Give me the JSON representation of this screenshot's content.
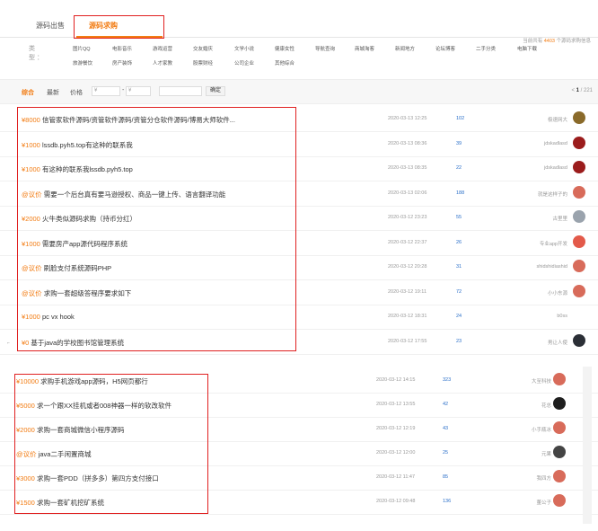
{
  "tabs": {
    "t1": "源码出售",
    "t2": "源码求购"
  },
  "total": {
    "prefix": "当前共有 ",
    "count": "4403",
    "suffix": " 个源码求购信息"
  },
  "categories": {
    "label": "类 型：",
    "items": [
      "图片QQ",
      "电影音乐",
      "游戏运营",
      "交友婚庆",
      "文学小说",
      "健康女性",
      "导航查询",
      "商城淘客",
      "新闻地方",
      "论坛博客",
      "二手分类",
      "电脑下载",
      "旅游餐饮",
      "房产装饰",
      "人才家教",
      "股票财经",
      "公司企业",
      "其他综合"
    ]
  },
  "filter": {
    "sort_all": "综合",
    "sort_new": "最新",
    "price_label": "价格",
    "min_ph": "¥",
    "sep": "-",
    "max_ph": "¥",
    "confirm": "确定",
    "pager_prefix": "< ",
    "pager_cur": "1",
    "pager_suffix": " / 221"
  },
  "rows1": [
    {
      "price": "¥8000",
      "title": " 信管家软件源码/资管软件源码/资管分仓软件源码/博易大师软件...",
      "date": "2020-03-13 12:25",
      "views": "102",
      "user": "极速网大"
    },
    {
      "price": "¥1000",
      "title": " lssdb.pyh5.top有这种的联系我",
      "date": "2020-03-13 08:36",
      "views": "39",
      "user": "jdskadlasd"
    },
    {
      "price": "¥1000",
      "title": " 有这种的联系我lssdb.pyh5.top",
      "date": "2020-03-13 08:35",
      "views": "22",
      "user": "jdskadlasd"
    },
    {
      "price": "@议价",
      "title": " 需要一个后台真有要马逊授权、商品一键上传、语言翻译功能",
      "date": "2020-03-13 02:06",
      "views": "188",
      "user": "就是这样子的"
    },
    {
      "price": "¥2000",
      "title": " 火牛类似源码求购（持币分红）",
      "date": "2020-03-12 23:23",
      "views": "55",
      "user": "古里里"
    },
    {
      "price": "¥1000",
      "title": " 需要房产app源代码程序系统",
      "date": "2020-03-12 22:37",
      "views": "26",
      "user": "专业app开发"
    },
    {
      "price": "@议价",
      "title": " 刷脸支付系统源码PHP",
      "date": "2020-03-12 20:28",
      "views": "31",
      "user": "shidshidiashid"
    },
    {
      "price": "@议价",
      "title": " 求购一套超级答程序要求如下",
      "date": "2020-03-12 19:11",
      "views": "72",
      "user": "小小东源"
    },
    {
      "price": "¥1000",
      "title": " pc vx hook",
      "date": "2020-03-12 18:31",
      "views": "24",
      "user": "b0ss"
    },
    {
      "price": "¥0",
      "title": " 基于java的学校图书馆管理系统",
      "date": "2020-03-12 17:55",
      "views": "23",
      "user": "男让人使"
    }
  ],
  "rows2": [
    {
      "price": "¥10000",
      "title": " 求购手机游戏app源码，H5网页都行",
      "date": "2020-03-12 14:15",
      "views": "323",
      "user": "大至科技"
    },
    {
      "price": "¥5000",
      "title": " 求一个跟XX挂机或者008神器一样的软改软件",
      "date": "2020-03-12 13:55",
      "views": "42",
      "user": "花总"
    },
    {
      "price": "¥2000",
      "title": " 求购一套商城微信小程序源码",
      "date": "2020-03-12 12:19",
      "views": "43",
      "user": "小手瓶冰"
    },
    {
      "price": "@议价",
      "title": " java二手闲置商城",
      "date": "2020-03-12 12:00",
      "views": "25",
      "user": "元果"
    },
    {
      "price": "¥3000",
      "title": " 求购一套PDD（拼多多）第四方支付接口",
      "date": "2020-03-12 11:47",
      "views": "85",
      "user": "我四方"
    },
    {
      "price": "¥1500",
      "title": " 求购一套矿机挖矿系统",
      "date": "2020-03-12 09:48",
      "views": "136",
      "user": "董公子"
    }
  ],
  "colors": {
    "accent": "#f27c13",
    "highlight_box": "#e02020",
    "views": "#2a6fc9"
  }
}
